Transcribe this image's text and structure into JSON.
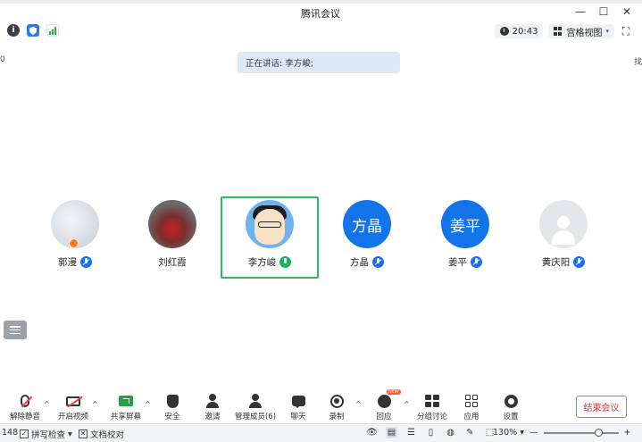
{
  "window": {
    "title": "腾讯会议",
    "min_label": "—",
    "max_label": "☐",
    "close_label": "✕"
  },
  "topbar": {
    "time": "20:43",
    "view_label": "宫格视图",
    "fullscreen_glyph": "⛶"
  },
  "edge": {
    "left_glyph": "0",
    "right_glyph": "找"
  },
  "speaking": {
    "text": "正在讲话: 李方峻;"
  },
  "participants": [
    {
      "name": "郭漫",
      "avatar": "photo",
      "avatar_text": "",
      "host": true,
      "speaking": false
    },
    {
      "name": "刘红霞",
      "avatar": "photo",
      "avatar_text": "",
      "host": false,
      "speaking": false
    },
    {
      "name": "李方峻",
      "avatar": "cartoon",
      "avatar_text": "",
      "host": false,
      "speaking": true
    },
    {
      "name": "方晶",
      "avatar": "text",
      "avatar_text": "方晶",
      "host": false,
      "speaking": false
    },
    {
      "name": "姜平",
      "avatar": "text",
      "avatar_text": "姜平",
      "host": false,
      "speaking": false
    },
    {
      "name": "黄庆阳",
      "avatar": "default",
      "avatar_text": "",
      "host": false,
      "speaking": false
    }
  ],
  "toolbar": {
    "unmute": "解除静音",
    "start_video": "开启视频",
    "share_screen": "共享屏幕",
    "security": "安全",
    "invite": "邀请",
    "members": "管理成员(6)",
    "chat": "聊天",
    "record": "录制",
    "reactions": "回应",
    "reactions_badge": "NEW",
    "breakout": "分组讨论",
    "apps": "应用",
    "settings": "设置",
    "end_meeting": "结束会议",
    "caret": "^"
  },
  "statusbar": {
    "word_count": "148",
    "spell_check": "拼写检查",
    "spell_caret": "▾",
    "doc_check": "文档校对",
    "zoom_level": "130%",
    "zoom_caret": "▾",
    "zoom_minus": "—",
    "zoom_plus": "+"
  },
  "colors": {
    "accent_blue": "#1373e9",
    "speaking_green": "#2bbd5c",
    "end_red": "#d9363e"
  }
}
